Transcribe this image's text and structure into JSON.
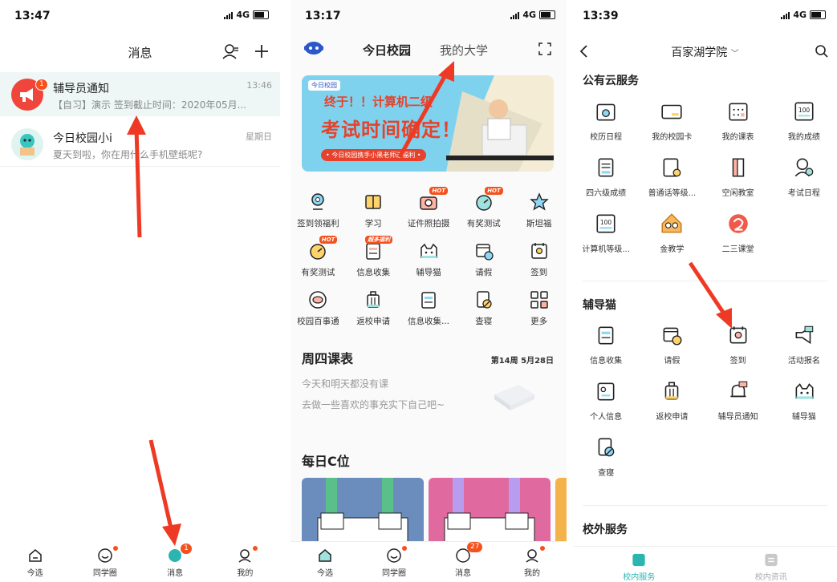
{
  "panel1": {
    "status": {
      "time": "13:47",
      "network": "4G"
    },
    "header": {
      "title": "消息"
    },
    "messages": [
      {
        "title": "辅导员通知",
        "subtitle": "【自习】演示 签到截止时间：2020年05月...",
        "time": "13:46",
        "badge": "1"
      },
      {
        "title": "今日校园小i",
        "subtitle": "夏天到啦，你在用什么手机壁纸呢?",
        "time": "星期日"
      }
    ],
    "tabs": [
      {
        "label": "今选"
      },
      {
        "label": "同学圈"
      },
      {
        "label": "消息",
        "badge": "1"
      },
      {
        "label": "我的"
      }
    ]
  },
  "panel2": {
    "status": {
      "time": "13:17",
      "network": "4G"
    },
    "header": {
      "tab_active": "今日校园",
      "tab_inactive": "我的大学"
    },
    "banner": {
      "brand": "今日校园",
      "line1": "终于！！计算机二级",
      "line2": "考试时间确定！",
      "caption": "• 今日校园携手小黑老师送福利 •"
    },
    "grid": [
      {
        "label": "签到领福利",
        "icon": "location-pin-icon"
      },
      {
        "label": "学习",
        "icon": "book-icon"
      },
      {
        "label": "证件照拍摄",
        "icon": "camera-icon",
        "hot": "HOT"
      },
      {
        "label": "有奖测试",
        "icon": "gauge-icon",
        "hot": "HOT"
      },
      {
        "label": "斯坦福",
        "icon": "star-icon"
      },
      {
        "label": "有奖测试",
        "icon": "gauge-icon",
        "hot": "HOT"
      },
      {
        "label": "信息收集",
        "icon": "form-icon",
        "hot": "超多福利"
      },
      {
        "label": "辅导猫",
        "icon": "cat-icon"
      },
      {
        "label": "请假",
        "icon": "calendar-clock-icon"
      },
      {
        "label": "签到",
        "icon": "checkin-icon"
      },
      {
        "label": "校园百事通",
        "icon": "chat-icon"
      },
      {
        "label": "返校申请",
        "icon": "luggage-icon"
      },
      {
        "label": "信息收集...",
        "icon": "form-icon"
      },
      {
        "label": "查寝",
        "icon": "bed-check-icon"
      },
      {
        "label": "更多",
        "icon": "grid-icon"
      }
    ],
    "schedule": {
      "title": "周四课表",
      "week": "第14周 5月28日",
      "empty1": "今天和明天都没有课",
      "empty2": "去做一些喜欢的事充实下自己吧~"
    },
    "daily": {
      "title": "每日C位"
    },
    "tabs": [
      {
        "label": "今选"
      },
      {
        "label": "同学圈"
      },
      {
        "label": "消息",
        "badge": "27"
      },
      {
        "label": "我的"
      }
    ]
  },
  "panel3": {
    "status": {
      "time": "13:39",
      "network": "4G"
    },
    "header": {
      "title": "百家湖学院"
    },
    "section1": {
      "title": "公有云服务",
      "items": [
        {
          "label": "校历日程",
          "icon": "calendar-icon"
        },
        {
          "label": "我的校园卡",
          "icon": "card-icon"
        },
        {
          "label": "我的课表",
          "icon": "timetable-icon"
        },
        {
          "label": "我的成绩",
          "icon": "score-icon"
        },
        {
          "label": "四六级成绩",
          "icon": "cet-icon"
        },
        {
          "label": "普通话等级...",
          "icon": "mandarin-icon"
        },
        {
          "label": "空闲教室",
          "icon": "door-icon"
        },
        {
          "label": "考试日程",
          "icon": "exam-icon"
        },
        {
          "label": "计算机等级...",
          "icon": "score-icon"
        },
        {
          "label": "金教学",
          "icon": "owl-icon"
        },
        {
          "label": "二三课堂",
          "icon": "class-icon"
        }
      ]
    },
    "section2": {
      "title": "辅导猫",
      "items": [
        {
          "label": "信息收集",
          "icon": "form-icon"
        },
        {
          "label": "请假",
          "icon": "calendar-clock-icon"
        },
        {
          "label": "签到",
          "icon": "checkin-icon"
        },
        {
          "label": "活动报名",
          "icon": "megaphone-icon"
        },
        {
          "label": "个人信息",
          "icon": "id-card-icon"
        },
        {
          "label": "返校申请",
          "icon": "luggage-icon"
        },
        {
          "label": "辅导员通知",
          "icon": "bell-icon"
        },
        {
          "label": "辅导猫",
          "icon": "cat-icon"
        },
        {
          "label": "查寝",
          "icon": "bed-check-icon"
        }
      ]
    },
    "section3": {
      "title": "校外服务"
    },
    "tabs": [
      {
        "label": "校内服务"
      },
      {
        "label": "校内资讯"
      }
    ]
  },
  "colors": {
    "accent": "#2bb5b0",
    "red": "#f4511e",
    "orange": "#f7a43b"
  }
}
